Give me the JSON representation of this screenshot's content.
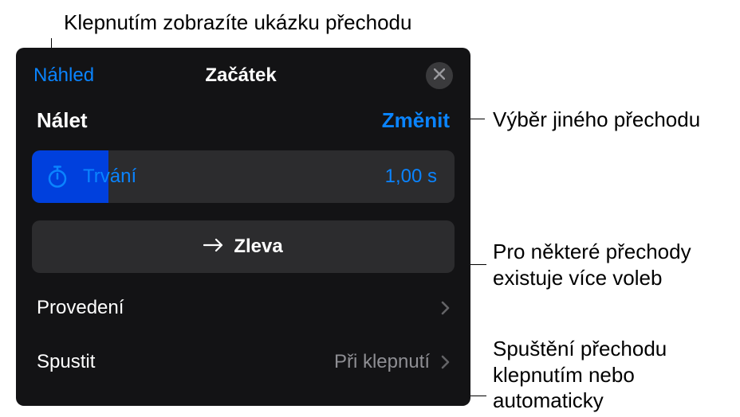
{
  "callouts": {
    "preview": "Klepnutím zobrazíte ukázku přechodu",
    "change": "Výběr jiného přechodu",
    "direction": "Pro některé přechody existuje více voleb",
    "start": "Spuštění přechodu klepnutím nebo automaticky"
  },
  "header": {
    "preview": "Náhled",
    "title": "Začátek"
  },
  "transition": {
    "name": "Nálet",
    "change": "Změnit"
  },
  "duration": {
    "label": "Trvání",
    "value": "1,00 s"
  },
  "direction": {
    "label": "Zleva"
  },
  "rows": {
    "delivery": {
      "label": "Provedení"
    },
    "start": {
      "label": "Spustit",
      "value": "Při klepnutí"
    }
  }
}
